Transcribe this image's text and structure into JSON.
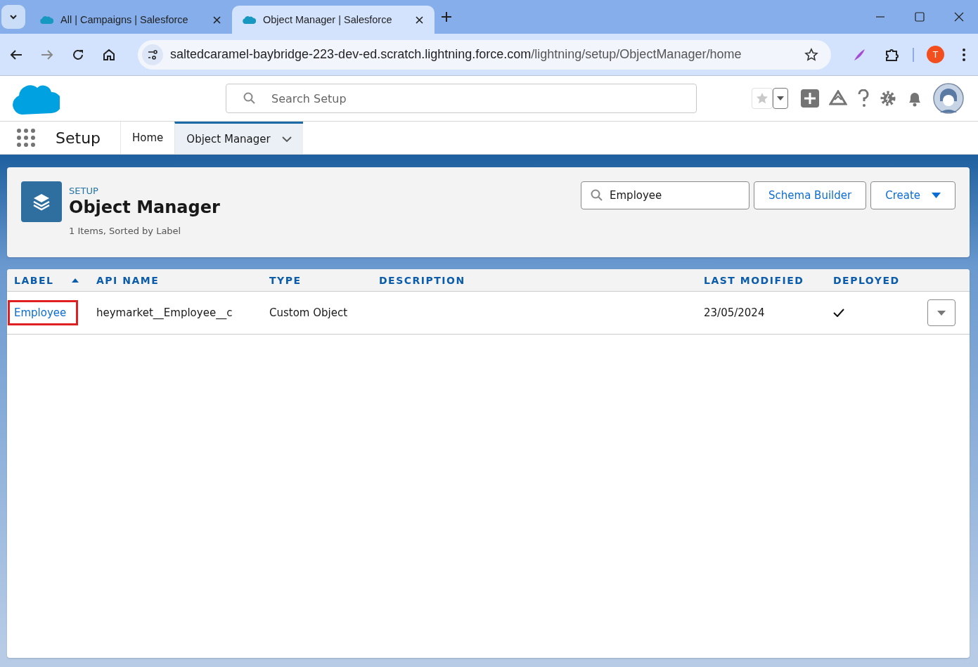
{
  "browser": {
    "tabs": [
      {
        "title": "All | Campaigns | Salesforce",
        "selected": false
      },
      {
        "title": "Object Manager | Salesforce",
        "selected": true
      }
    ],
    "url": {
      "host": "saltedcaramel-baybridge-223-dev-ed.scratch.lightning.force.com",
      "path": "/lightning/setup/ObjectManager/home"
    },
    "profile_initial": "T"
  },
  "header": {
    "search": {
      "placeholder": "Search Setup"
    }
  },
  "nav": {
    "app_name": "Setup",
    "tabs": [
      {
        "label": "Home",
        "selected": false
      },
      {
        "label": "Object Manager",
        "selected": true
      }
    ]
  },
  "page_header": {
    "eyebrow": "SETUP",
    "title": "Object Manager",
    "subtitle": "1 Items, Sorted by Label",
    "search": {
      "value": "Employee"
    },
    "buttons": [
      {
        "label": "Schema Builder",
        "kind": "plain"
      },
      {
        "label": "Create",
        "kind": "menu"
      }
    ]
  },
  "table": {
    "columns": [
      {
        "label": "LABEL",
        "sorted": true
      },
      {
        "label": "API NAME",
        "sorted": false
      },
      {
        "label": "TYPE",
        "sorted": false
      },
      {
        "label": "DESCRIPTION",
        "sorted": false
      },
      {
        "label": "LAST MODIFIED",
        "sorted": false
      },
      {
        "label": "DEPLOYED",
        "sorted": false
      }
    ],
    "rows": [
      {
        "label": "Employee",
        "api_name": "heymarket__Employee__c",
        "type": "Custom Object",
        "last_modified": "23/05/2024",
        "deployed": true,
        "highlighted": true
      }
    ]
  }
}
